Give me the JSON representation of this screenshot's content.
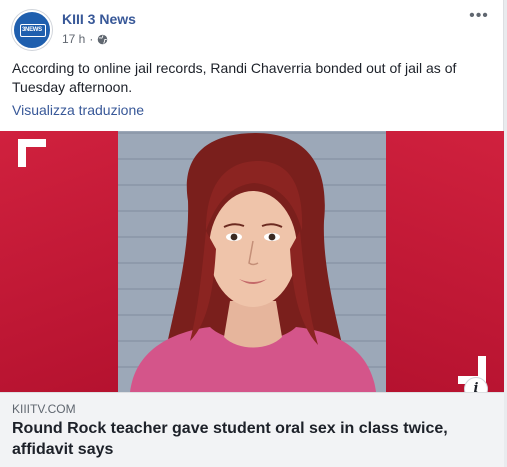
{
  "post": {
    "page_name": "KIII 3 News",
    "timestamp": "17 h",
    "separator": "·",
    "privacy_icon": "globe-icon",
    "more_label": "•••",
    "text": "According to online jail records, Randi Chaverria bonded out of jail as of Tuesday afternoon.",
    "see_translation": "Visualizza traduzione"
  },
  "avatar": {
    "logo_text": "3NEWS"
  },
  "media": {
    "info_label": "i"
  },
  "link_preview": {
    "domain": "KIIITV.COM",
    "title": "Round Rock teacher gave student oral sex in class twice, affidavit says"
  },
  "colors": {
    "page_name": "#385898",
    "brand_red": "#c6173a",
    "card_bg": "#f2f3f5"
  }
}
